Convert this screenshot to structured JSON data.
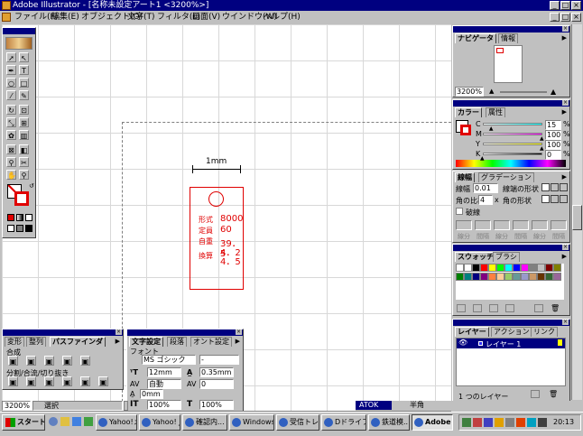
{
  "window": {
    "title": "Adobe Illustrator - [名称未設定アート1 <3200%>]"
  },
  "menu": [
    "ファイル(F)",
    "編集(E)",
    "オブジェクト(O)",
    "文字(T)",
    "フィルタ(L)",
    "画面(V)",
    "ウインドウ(W)",
    "ヘルプ(H)"
  ],
  "artboard": {
    "dimension_label": "1mm",
    "rows": [
      {
        "label": "形式",
        "value": "8000"
      },
      {
        "label": "定員",
        "value": "60"
      },
      {
        "label": "自重",
        "value": "39．5"
      },
      {
        "label": "換算",
        "value": "4．2"
      },
      {
        "label": "",
        "value": "4．5"
      }
    ]
  },
  "navigator": {
    "tabs": [
      "ナビゲータ",
      "情報"
    ],
    "zoom": "3200%"
  },
  "color_panel": {
    "tabs": [
      "カラー",
      "属性"
    ],
    "channels": [
      {
        "name": "C",
        "value": "15",
        "unit": "%",
        "color": "#00ffff"
      },
      {
        "name": "M",
        "value": "100",
        "unit": "%",
        "color": "#ff00ff"
      },
      {
        "name": "Y",
        "value": "100",
        "unit": "%",
        "color": "#ffff00"
      },
      {
        "name": "K",
        "value": "0",
        "unit": "%",
        "color": "#000000"
      }
    ]
  },
  "stroke_panel": {
    "tabs": [
      "線幅",
      "グラデーション"
    ],
    "weight_label": "線幅",
    "weight_value": "0.01",
    "cap_label": "線端の形状",
    "miter_label": "角の比率",
    "miter_value": "4",
    "miter_unit": "x",
    "join_label": "角の形状",
    "dashed_label": "破線",
    "dash_labels": [
      "線分",
      "間隔",
      "線分",
      "間隔",
      "線分",
      "間隔"
    ]
  },
  "swatch_panel": {
    "tabs": [
      "スウォッチ",
      "ブラシ"
    ],
    "colors": [
      "#ffffff",
      "#ffffff",
      "#000000",
      "#ff0000",
      "#ffff00",
      "#00ff00",
      "#00ffff",
      "#0000ff",
      "#ff00ff",
      "#808080",
      "#c0c0c0",
      "#800000",
      "#808000",
      "#008000",
      "#008080",
      "#000080",
      "#800080",
      "#ff8040",
      "#ffcc99",
      "#99cc66",
      "#669999",
      "#9999cc",
      "#cc9966",
      "#663300",
      "#336633",
      "#996699"
    ]
  },
  "layers_panel": {
    "tabs": [
      "レイヤー",
      "アクション",
      "リンク"
    ],
    "layer_name": "レイヤー 1",
    "count_text": "1 つのレイヤー"
  },
  "pathfinder_panel": {
    "tabs": [
      "変形",
      "整列",
      "パスファインダ"
    ],
    "combine_label": "合成",
    "divide_label": "分割/合流/切り抜き"
  },
  "type_panel": {
    "tabs": [
      "文字設定",
      "段落",
      "オント設定"
    ],
    "font_label": "フォント",
    "font_value": "MS ゴシック",
    "font_style": "-",
    "size_value": "12mm",
    "leading_value": "0.35mm",
    "tracking_value": "自動",
    "kerning_value": "0",
    "baseline_value": "0mm",
    "hscale_value": "100%",
    "vscale_value": "100%"
  },
  "statusbar": {
    "zoom": "3200%",
    "tool": "選択"
  },
  "taskbar": {
    "start_label": "スタート",
    "tasks": [
      "Yahoo!メ...",
      "Yahoo! J...",
      "確認内...",
      "Windows...",
      "受信トレ...",
      "Dドライブ...",
      "鉄道模...",
      "Adobe ..."
    ],
    "ime_label": "ATOK",
    "ime_mode": "半角",
    "clock": "20:13"
  }
}
